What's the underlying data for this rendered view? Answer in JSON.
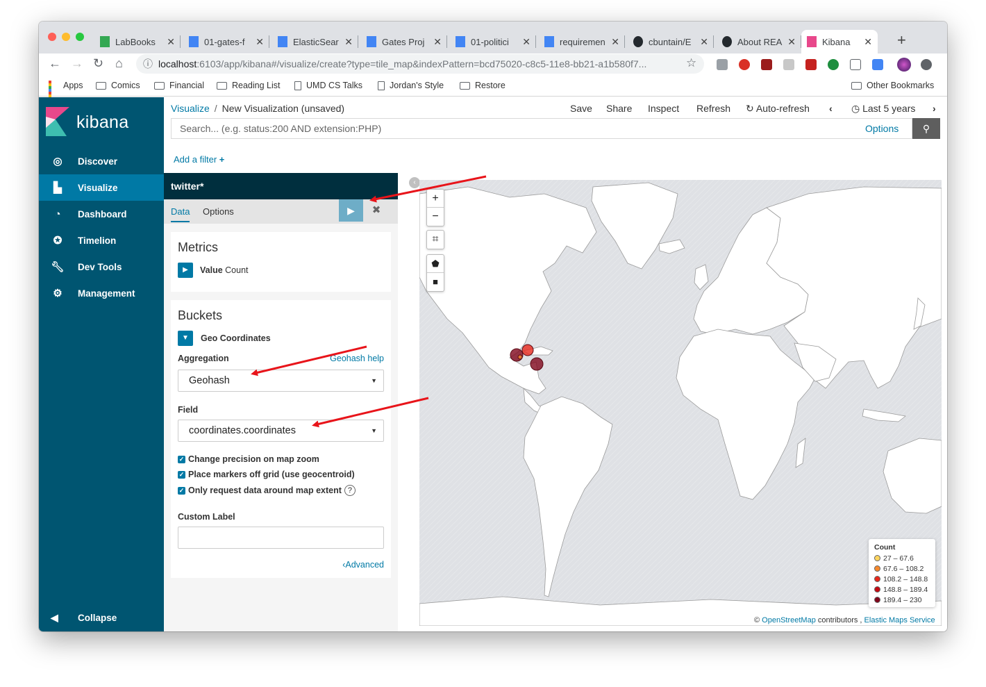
{
  "browser": {
    "tabs": [
      {
        "title": "LabBooks",
        "icon": "drive-icon"
      },
      {
        "title": "01-gates-f",
        "icon": "docs-icon"
      },
      {
        "title": "ElasticSear",
        "icon": "docs-icon"
      },
      {
        "title": "Gates Proj",
        "icon": "docs-icon"
      },
      {
        "title": "01-politici",
        "icon": "docs-icon"
      },
      {
        "title": "requiremen",
        "icon": "docs-icon"
      },
      {
        "title": "cbuntain/E",
        "icon": "github-icon"
      },
      {
        "title": "About REA",
        "icon": "github-icon"
      },
      {
        "title": "Kibana",
        "icon": "kibana-icon",
        "active": true
      }
    ],
    "url_host": "localhost",
    "url_path": ":6103/app/kibana#/visualize/create?type=tile_map&indexPattern=bcd75020-c8c5-11e8-bb21-a1b580f7...",
    "bookmarks": [
      {
        "label": "Apps",
        "icon": "apps-grid-icon"
      },
      {
        "label": "Comics",
        "icon": "folder-icon"
      },
      {
        "label": "Financial",
        "icon": "folder-icon"
      },
      {
        "label": "Reading List",
        "icon": "folder-icon"
      },
      {
        "label": "UMD CS Talks",
        "icon": "page-icon"
      },
      {
        "label": "Jordan's Style",
        "icon": "page-icon"
      },
      {
        "label": "Restore",
        "icon": "folder-icon"
      }
    ],
    "other_bookmarks": "Other Bookmarks"
  },
  "kibana": {
    "logo_text": "kibana",
    "nav": [
      {
        "label": "Discover",
        "icon": "compass-icon"
      },
      {
        "label": "Visualize",
        "icon": "bar-chart-icon",
        "active": true
      },
      {
        "label": "Dashboard",
        "icon": "dashboard-icon"
      },
      {
        "label": "Timelion",
        "icon": "timelion-icon"
      },
      {
        "label": "Dev Tools",
        "icon": "wrench-icon"
      },
      {
        "label": "Management",
        "icon": "gear-icon"
      }
    ],
    "collapse_label": "Collapse",
    "breadcrumb": {
      "root": "Visualize",
      "current": "New Visualization (unsaved)"
    },
    "top_menu": {
      "save": "Save",
      "share": "Share",
      "inspect": "Inspect",
      "refresh": "Refresh",
      "auto_refresh": "Auto-refresh",
      "time_range": "Last 5 years"
    },
    "search": {
      "placeholder": "Search... (e.g. status:200 AND extension:PHP)",
      "options": "Options"
    },
    "add_filter": "Add a filter"
  },
  "editor": {
    "index_pattern": "twitter*",
    "tabs": {
      "data": "Data",
      "options": "Options"
    },
    "metrics": {
      "title": "Metrics",
      "item_label": "Value",
      "item_value": "Count"
    },
    "buckets": {
      "title": "Buckets",
      "item": "Geo Coordinates",
      "aggregation_label": "Aggregation",
      "aggregation_help": "Geohash help",
      "aggregation_value": "Geohash",
      "field_label": "Field",
      "field_value": "coordinates.coordinates",
      "checkboxes": [
        {
          "label": "Change precision on map zoom",
          "checked": true
        },
        {
          "label": "Place markers off grid (use geocentroid)",
          "checked": true
        },
        {
          "label": "Only request data around map extent",
          "checked": true
        }
      ],
      "custom_label": "Custom Label",
      "custom_label_value": "",
      "advanced": "Advanced"
    }
  },
  "map": {
    "legend": {
      "title": "Count",
      "ranges": [
        {
          "label": "27 – 67.6",
          "color": "#fed55f"
        },
        {
          "label": "67.6 – 108.2",
          "color": "#f6892d"
        },
        {
          "label": "108.2 – 148.8",
          "color": "#e8281b"
        },
        {
          "label": "148.8 – 189.4",
          "color": "#c40a12"
        },
        {
          "label": "189.4 – 230",
          "color": "#80061b"
        }
      ]
    },
    "attribution": {
      "osm": "OpenStreetMap",
      "contributors": "contributors ,",
      "ems": "Elastic Maps Service"
    },
    "zoom_in": "+",
    "zoom_out": "−",
    "colors": {
      "water": "#dfe1e5",
      "land": "#ffffff",
      "accent": "#0079a5",
      "sidebar": "#005571"
    }
  }
}
